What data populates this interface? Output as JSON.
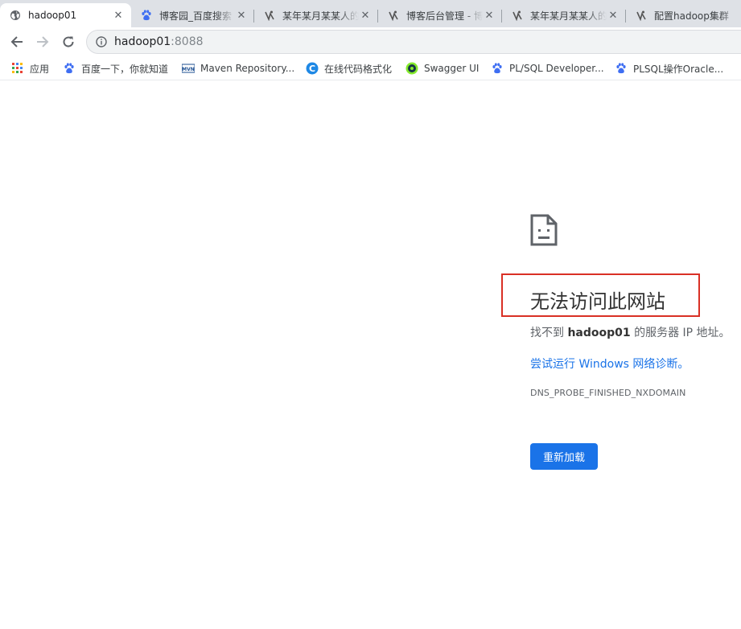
{
  "tabs": [
    {
      "title": "hadoop01",
      "icon": "globe-icon",
      "active": true
    },
    {
      "title": "博客园_百度搜索",
      "icon": "baidu-paw-icon",
      "active": false
    },
    {
      "title": "某年某月某某人的",
      "icon": "cnblogs-icon",
      "active": false
    },
    {
      "title": "博客后台管理 - 博",
      "icon": "cnblogs-icon",
      "active": false
    },
    {
      "title": "某年某月某某人的",
      "icon": "cnblogs-icon",
      "active": false
    },
    {
      "title": "配置hadoop集群",
      "icon": "cnblogs-icon",
      "active": false
    }
  ],
  "omnibox": {
    "host": "hadoop01",
    "port": ":8088"
  },
  "bookmarks": [
    {
      "label": "应用",
      "icon": "apps-grid-icon"
    },
    {
      "label": "百度一下，你就知道",
      "icon": "baidu-paw-icon"
    },
    {
      "label": "Maven Repository...",
      "icon": "maven-icon"
    },
    {
      "label": "在线代码格式化",
      "icon": "code-format-icon"
    },
    {
      "label": "Swagger UI",
      "icon": "swagger-icon"
    },
    {
      "label": "PL/SQL Developer...",
      "icon": "baidu-paw-icon"
    },
    {
      "label": "PLSQL操作Oracle...",
      "icon": "baidu-paw-icon"
    }
  ],
  "error": {
    "title": "无法访问此网站",
    "desc_prefix": "找不到 ",
    "desc_host": "hadoop01",
    "desc_suffix": " 的服务器 IP 地址。",
    "suggestion": "尝试运行 Windows 网络诊断。",
    "code": "DNS_PROBE_FINISHED_NXDOMAIN",
    "reload_label": "重新加载"
  },
  "colors": {
    "accent": "#1a73e8",
    "highlight_box": "#d93025",
    "tabstrip": "#dee1e6"
  }
}
